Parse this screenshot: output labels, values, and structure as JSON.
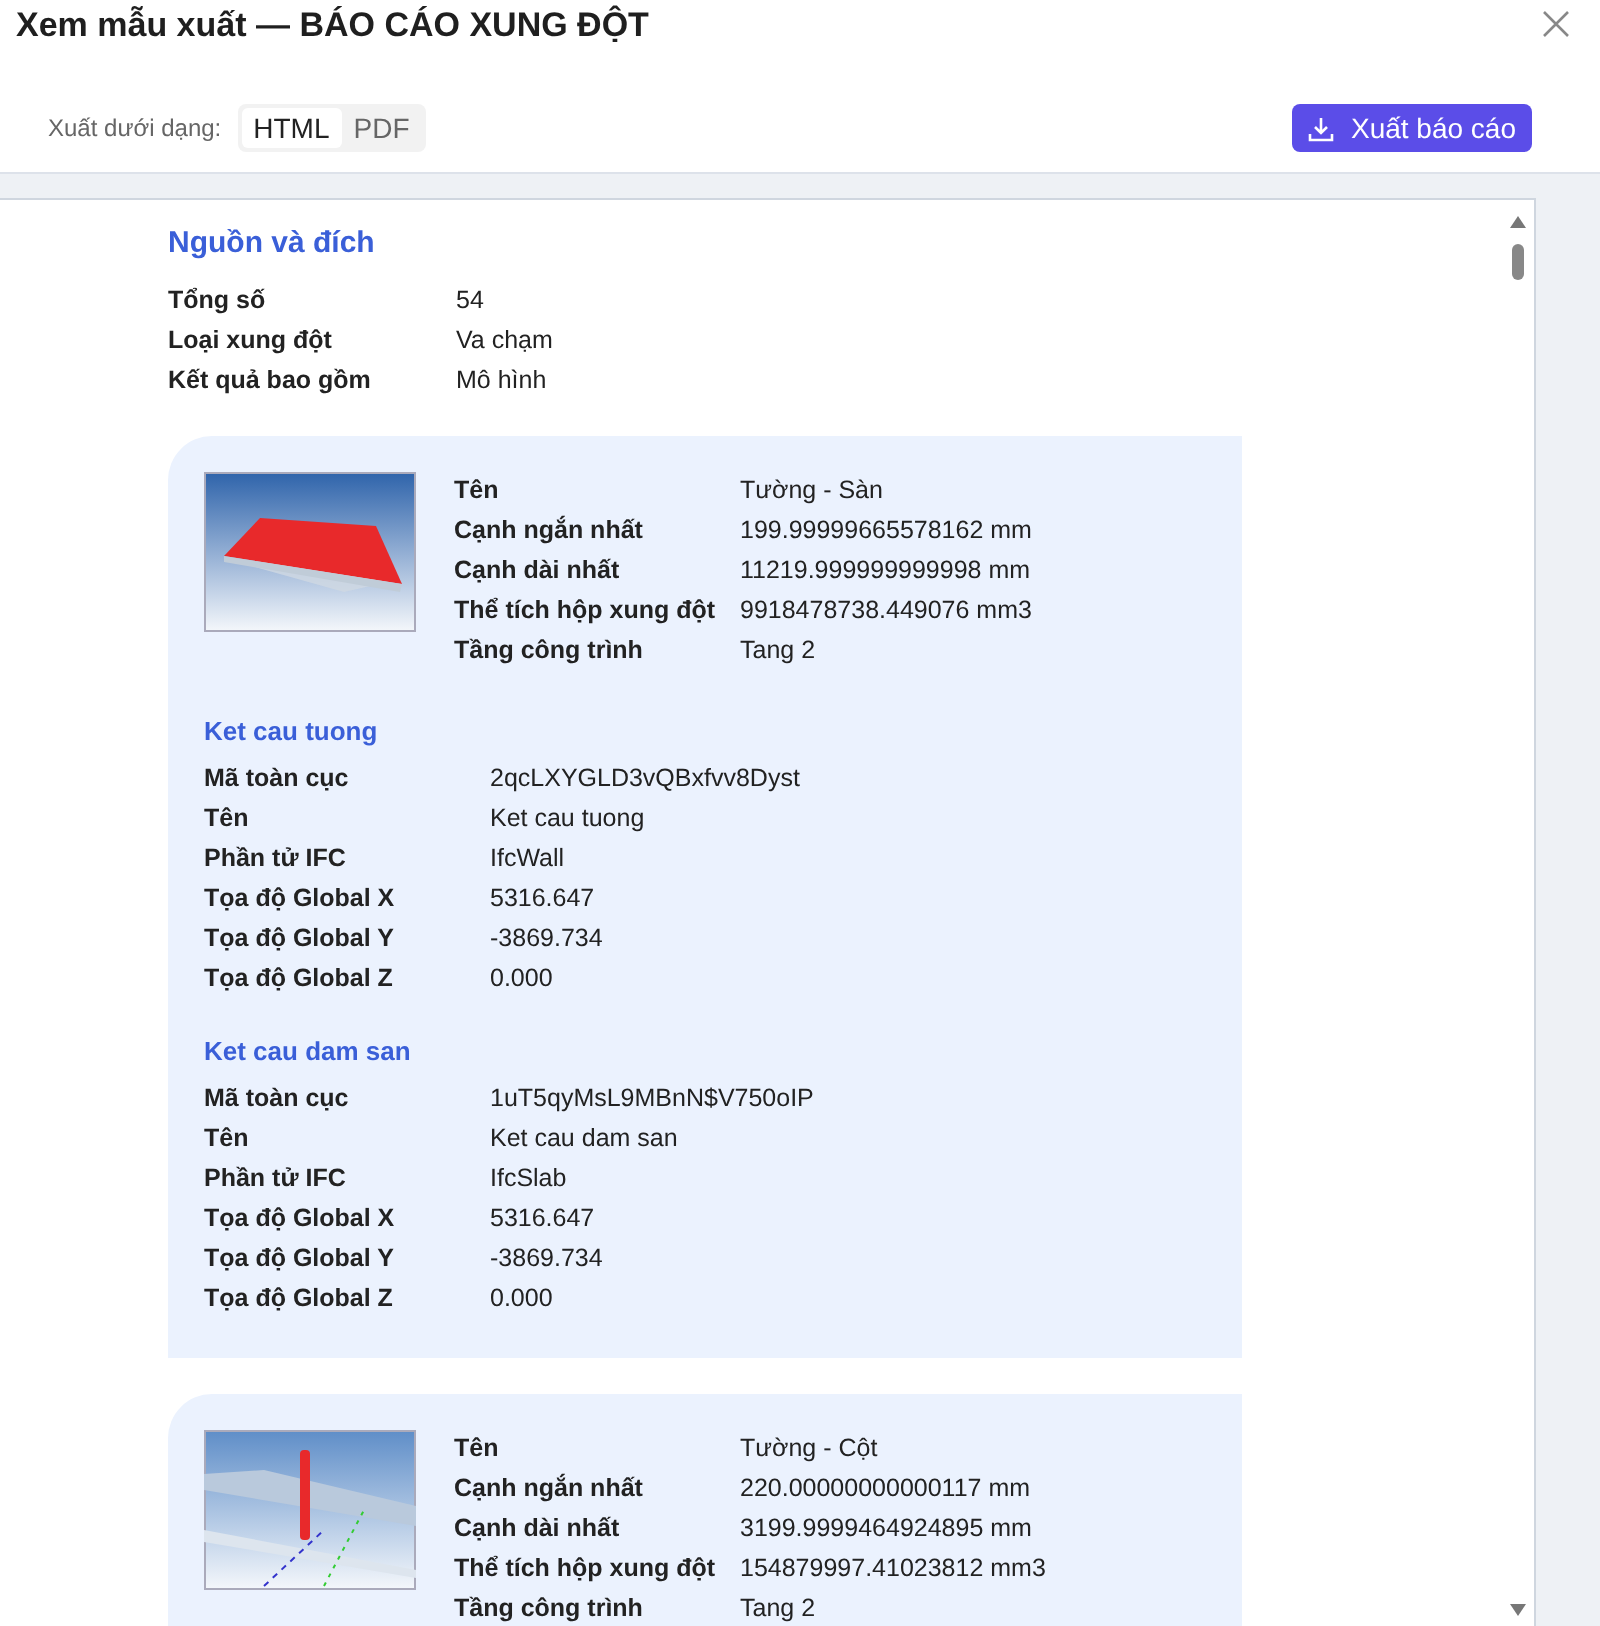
{
  "dialog": {
    "title": "Xem mẫu xuất — BÁO CÁO XUNG ĐỘT"
  },
  "export": {
    "label": "Xuất dưới dạng:",
    "formats": [
      {
        "label": "HTML",
        "selected": true
      },
      {
        "label": "PDF",
        "selected": false
      }
    ],
    "button": "Xuất báo cáo"
  },
  "report": {
    "heading": "Nguồn và đích",
    "summary": [
      {
        "label": "Tổng số",
        "value": "54"
      },
      {
        "label": "Loại xung đột",
        "value": "Va chạm"
      },
      {
        "label": "Kết quả bao gồm",
        "value": "Mô hình"
      }
    ],
    "clashes": [
      {
        "kind": "slab",
        "properties": [
          {
            "label": "Tên",
            "value": "Tường - Sàn"
          },
          {
            "label": "Cạnh ngắn nhất",
            "value": "199.99999665578162 mm"
          },
          {
            "label": "Cạnh dài nhất",
            "value": "11219.999999999998 mm"
          },
          {
            "label": "Thể tích hộp xung đột",
            "value": "9918478738.449076 mm3"
          },
          {
            "label": "Tầng công trình",
            "value": "Tang 2"
          }
        ],
        "elements": [
          {
            "title": "Ket cau tuong",
            "properties": [
              {
                "label": "Mã toàn cục",
                "value": "2qcLXYGLD3vQBxfvv8Dyst"
              },
              {
                "label": "Tên",
                "value": "Ket cau tuong"
              },
              {
                "label": "Phần tử IFC",
                "value": "IfcWall"
              },
              {
                "label": "Tọa độ Global X",
                "value": "5316.647"
              },
              {
                "label": "Tọa độ Global Y",
                "value": "-3869.734"
              },
              {
                "label": "Tọa độ Global Z",
                "value": "0.000"
              }
            ]
          },
          {
            "title": "Ket cau dam san",
            "properties": [
              {
                "label": "Mã toàn cục",
                "value": "1uT5qyMsL9MBnN$V750oIP"
              },
              {
                "label": "Tên",
                "value": "Ket cau dam san"
              },
              {
                "label": "Phần tử IFC",
                "value": "IfcSlab"
              },
              {
                "label": "Tọa độ Global X",
                "value": "5316.647"
              },
              {
                "label": "Tọa độ Global Y",
                "value": "-3869.734"
              },
              {
                "label": "Tọa độ Global Z",
                "value": "0.000"
              }
            ]
          }
        ]
      },
      {
        "kind": "column",
        "properties": [
          {
            "label": "Tên",
            "value": "Tường - Cột"
          },
          {
            "label": "Cạnh ngắn nhất",
            "value": "220.00000000000117 mm"
          },
          {
            "label": "Cạnh dài nhất",
            "value": "3199.9999464924895 mm"
          },
          {
            "label": "Thể tích hộp xung đột",
            "value": "154879997.41023812 mm3"
          },
          {
            "label": "Tầng công trình",
            "value": "Tang 2"
          }
        ]
      }
    ]
  }
}
